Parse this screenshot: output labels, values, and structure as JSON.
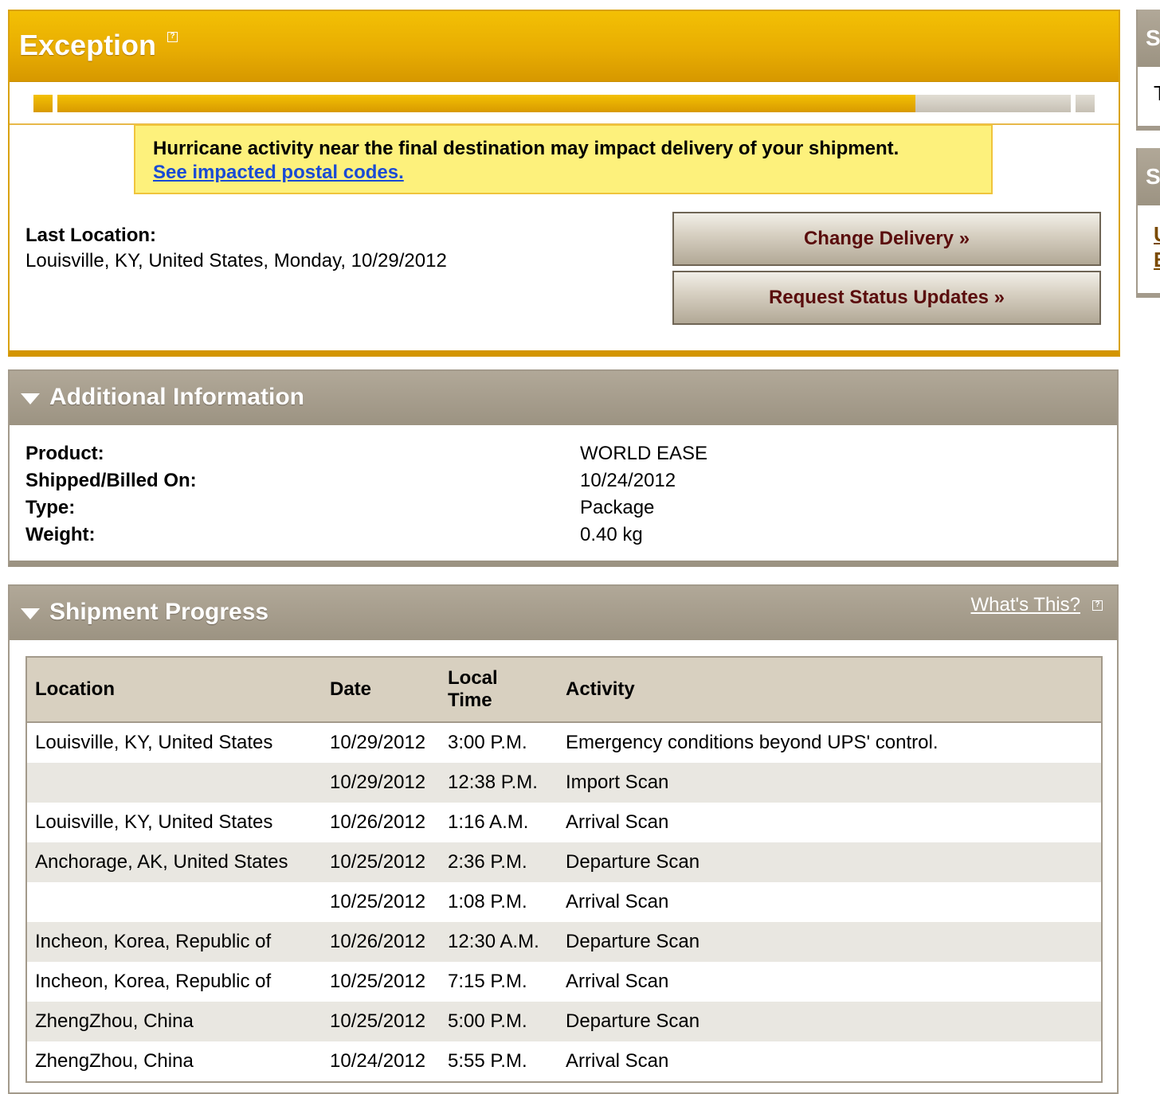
{
  "exception": {
    "title": "Exception",
    "help_icon": "?",
    "progress_fraction": 0.847,
    "alert": {
      "text": "Hurricane activity near the final destination may impact delivery of your shipment.",
      "link": "See impacted postal codes."
    },
    "last_location_label": "Last Location:",
    "last_location_value": "Louisville, KY, United States, Monday, 10/29/2012",
    "buttons": {
      "change_delivery": "Change Delivery »",
      "request_updates": "Request Status Updates »"
    }
  },
  "additional": {
    "title": "Additional Information",
    "rows": [
      {
        "label": "Product:",
        "value": "WORLD EASE"
      },
      {
        "label": "Shipped/Billed On:",
        "value": "10/24/2012"
      },
      {
        "label": "Type:",
        "value": "Package"
      },
      {
        "label": "Weight:",
        "value": "0.40 kg"
      }
    ]
  },
  "progress": {
    "title": "Shipment Progress",
    "whats_this": "What's This?",
    "columns": {
      "location": "Location",
      "date": "Date",
      "time_line1": "Local",
      "time_line2": "Time",
      "activity": "Activity"
    },
    "rows": [
      {
        "location": "Louisville, KY, United States",
        "date": "10/29/2012",
        "time": "3:00 P.M.",
        "activity": "Emergency conditions beyond UPS' control."
      },
      {
        "location": "",
        "date": "10/29/2012",
        "time": "12:38 P.M.",
        "activity": "Import Scan"
      },
      {
        "location": "Louisville, KY, United States",
        "date": "10/26/2012",
        "time": "1:16 A.M.",
        "activity": "Arrival Scan"
      },
      {
        "location": "Anchorage, AK, United States",
        "date": "10/25/2012",
        "time": "2:36 P.M.",
        "activity": "Departure Scan"
      },
      {
        "location": "",
        "date": "10/25/2012",
        "time": "1:08 P.M.",
        "activity": "Arrival Scan"
      },
      {
        "location": "Incheon, Korea, Republic of",
        "date": "10/26/2012",
        "time": "12:30 A.M.",
        "activity": "Departure Scan"
      },
      {
        "location": "Incheon, Korea, Republic of",
        "date": "10/25/2012",
        "time": "7:15 P.M.",
        "activity": "Arrival Scan"
      },
      {
        "location": "ZhengZhou, China",
        "date": "10/25/2012",
        "time": "5:00 P.M.",
        "activity": "Departure Scan"
      },
      {
        "location": "ZhengZhou, China",
        "date": "10/24/2012",
        "time": "5:55 P.M.",
        "activity": "Arrival Scan"
      }
    ]
  },
  "sidebar": {
    "box1_head": "S",
    "box1_text": "T",
    "box2_head": "S",
    "box2_links": [
      "U",
      "E"
    ]
  }
}
